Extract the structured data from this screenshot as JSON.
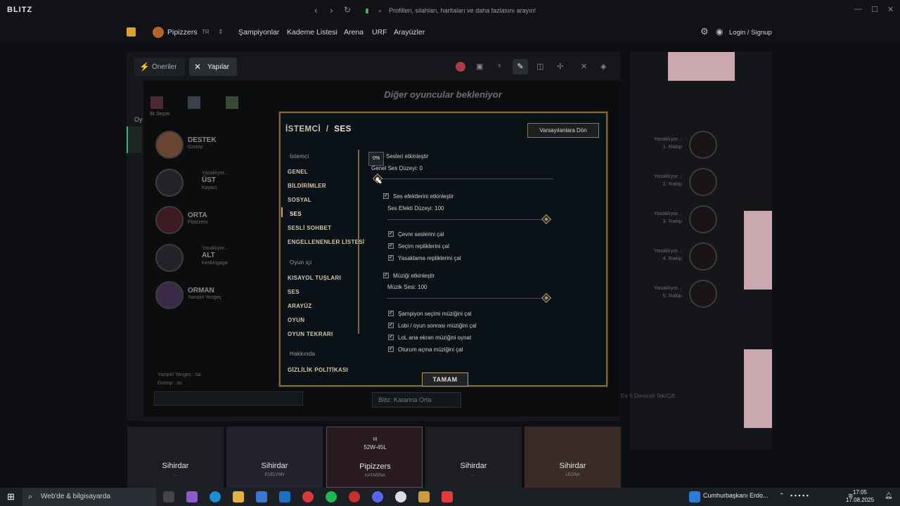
{
  "app": {
    "logo": "BLITZ",
    "search_placeholder": "Profilleri, silahları, haritaları ve daha fazlasını arayın!"
  },
  "navbar": {
    "profile_name": "Pipizzers",
    "region": "TR",
    "links": [
      "Şampiyonlar",
      "Kademe Listesi",
      "Arena",
      "URF",
      "Arayüzler"
    ],
    "login": "Login / Signup"
  },
  "toolbar": {
    "suggestions": "Öneriler",
    "builds": "Yapılar"
  },
  "lobby": {
    "waiting": "Diğer oyuncular bekleniyor",
    "first_pick": "İlk Seçim",
    "allies": [
      {
        "role": "DESTEK",
        "name": "Gromp",
        "status": ""
      },
      {
        "role": "ÜST",
        "name": "Kayaci",
        "status": "Yasaklıyor..."
      },
      {
        "role": "ORTA",
        "name": "Pipizzers",
        "status": ""
      },
      {
        "role": "ALT",
        "name": "Keskingaga",
        "status": "Yasaklıyor..."
      },
      {
        "role": "ORMAN",
        "name": "Yampiri Yengeç",
        "status": ""
      }
    ],
    "enemies": [
      {
        "status": "Yasaklıyor...",
        "label": "1. Rakip"
      },
      {
        "status": "Yasaklıyor...",
        "label": "2. Rakip"
      },
      {
        "status": "Yasaklıyor...",
        "label": "3. Rakip"
      },
      {
        "status": "Yasaklıyor...",
        "label": "4. Rakip"
      },
      {
        "status": "Yasaklıyor...",
        "label": "5. Rakip"
      }
    ],
    "chat": [
      "Yampiri Yengeç : sa",
      "Gromp : as"
    ],
    "build_select": "Blitz: Katarina Orta",
    "queue": "5'e 5 Dereceli Tek/Çift"
  },
  "dialog": {
    "crumb_parent": "İSTEMCİ",
    "crumb_sep": "/",
    "crumb_current": "SES",
    "reset_button": "Varsayılanlara Dön",
    "ok_button": "TAMAM",
    "sidebar": {
      "client_header": "İstemci",
      "client_items": [
        "GENEL",
        "BİLDİRİMLER",
        "SOSYAL",
        "SES",
        "SESLİ SOHBET",
        "ENGELLENENLER LİSTESİ"
      ],
      "ingame_header": "Oyun içi",
      "ingame_items": [
        "KISAYOL TUŞLARI",
        "SES",
        "ARAYÜZ",
        "OYUN",
        "OYUN TEKRARI"
      ],
      "about_header": "Hakkında",
      "about_items": [
        "GİZLİLİK POLİTİKASI"
      ],
      "selected_index": 3
    },
    "tooltip": "0%",
    "settings": {
      "master": {
        "label": "Sesleri etkinleştir",
        "checked": true,
        "level_label": "Genel Ses Düzeyi: 0",
        "level": 0
      },
      "sfx": {
        "label": "Ses efektlerini etkinleştir",
        "checked": true,
        "level_label": "Ses Efekti Düzeyi: 100",
        "level": 100
      },
      "sfx_options": [
        {
          "label": "Çevre seslerini çal",
          "checked": true
        },
        {
          "label": "Seçim repliklerini çal",
          "checked": true
        },
        {
          "label": "Yasaklama repliklerini çal",
          "checked": true
        }
      ],
      "music": {
        "label": "Müziği etkinleştir",
        "checked": true,
        "level_label": "Müzik Sesi: 100",
        "level": 100
      },
      "music_options": [
        {
          "label": "Şampiyon seçimi müziğini çal",
          "checked": true
        },
        {
          "label": "Lobi / oyun sonrası müziğini çal",
          "checked": true
        },
        {
          "label": "LoL ana ekran müziğini oynat",
          "checked": true
        },
        {
          "label": "Oturum açma müziğini çal",
          "checked": true
        }
      ]
    }
  },
  "bottom_cards": [
    {
      "name": "Sihirdar",
      "sub": "..."
    },
    {
      "name": "Sihirdar",
      "sub": "EVELYNN"
    },
    {
      "name": "Pipizzers",
      "sub": "KATARİNA",
      "record": "52W-45L",
      "tier": "III"
    },
    {
      "name": "Sihirdar",
      "sub": "..."
    },
    {
      "name": "Sihirdar",
      "sub": "LEONA"
    }
  ],
  "taskbar": {
    "search": "Web'de & bilgisayarda",
    "news": "Cumhurbaşkanı Erdo...",
    "time": "17:05",
    "date": "17.08.2025"
  }
}
